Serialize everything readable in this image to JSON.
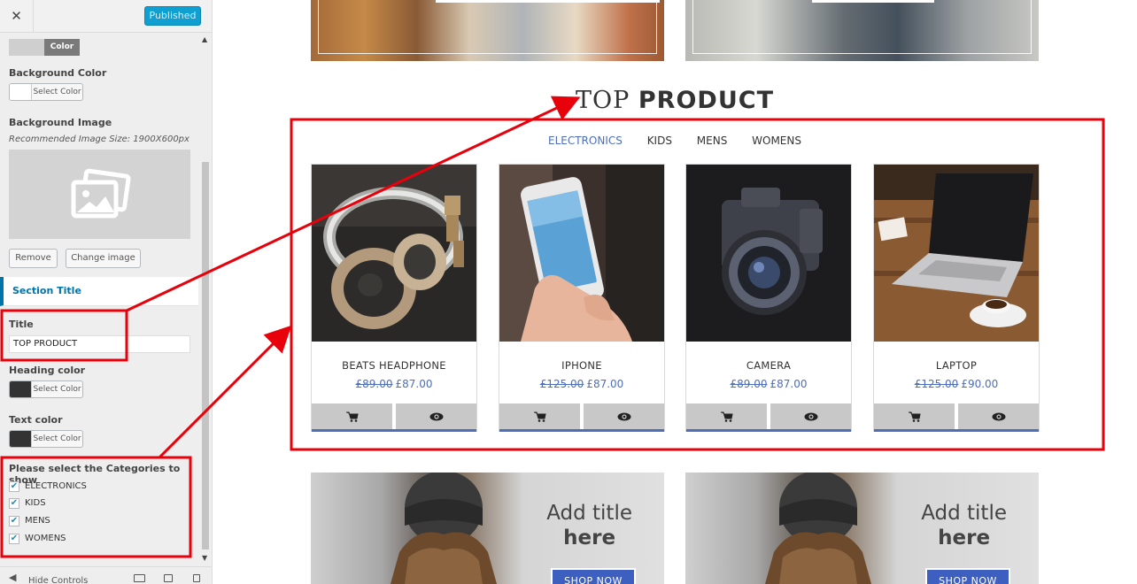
{
  "sidebar": {
    "close_label": "✕",
    "published_label": "Published",
    "color_tab_label": "Color",
    "background_color_label": "Background Color",
    "background_image_label": "Background Image",
    "recommended_size": "Recommended Image Size: 1900X600px",
    "select_color_label": "Select Color",
    "remove_label": "Remove",
    "change_image_label": "Change image",
    "section_title": "Section Title",
    "title_label": "Title",
    "title_value": "TOP PRODUCT",
    "heading_color_label": "Heading color",
    "text_color_label": "Text color",
    "categories_label": "Please select the Categories to show",
    "categories": [
      {
        "label": "ELECTRONICS",
        "checked": true
      },
      {
        "label": "KIDS",
        "checked": true
      },
      {
        "label": "MENS",
        "checked": true
      },
      {
        "label": "WOMENS",
        "checked": true
      }
    ],
    "hide_controls_label": "Hide Controls",
    "colors": {
      "background_swatch": "#ffffff",
      "heading_swatch": "#333333",
      "text_swatch": "#333333",
      "accent": "#0073aa",
      "published": "#0f9fd1"
    }
  },
  "preview": {
    "section_title_light": "TOP",
    "section_title_bold": "PRODUCT",
    "tabs": [
      {
        "label": "ELECTRONICS",
        "active": true
      },
      {
        "label": "KIDS",
        "active": false
      },
      {
        "label": "MENS",
        "active": false
      },
      {
        "label": "WOMENS",
        "active": false
      }
    ],
    "products": [
      {
        "name": "BEATS HEADPHONE",
        "old_price": "£89.00",
        "price": "£87.00",
        "image": "headphone-image"
      },
      {
        "name": "IPHONE",
        "old_price": "£125.00",
        "price": "£87.00",
        "image": "phone-image"
      },
      {
        "name": "CAMERA",
        "old_price": "£89.00",
        "price": "£87.00",
        "image": "camera-image"
      },
      {
        "name": "LAPTOP",
        "old_price": "£125.00",
        "price": "£90.00",
        "image": "laptop-image"
      }
    ],
    "promos": [
      {
        "title_line1": "Add title",
        "title_line2": "here",
        "button": "SHOP NOW"
      },
      {
        "title_line1": "Add title",
        "title_line2": "here",
        "button": "SHOP NOW"
      }
    ],
    "colors": {
      "accent": "#4d6eb8",
      "action_bg": "#c8c8c8",
      "annotation": "#e8000b"
    }
  }
}
